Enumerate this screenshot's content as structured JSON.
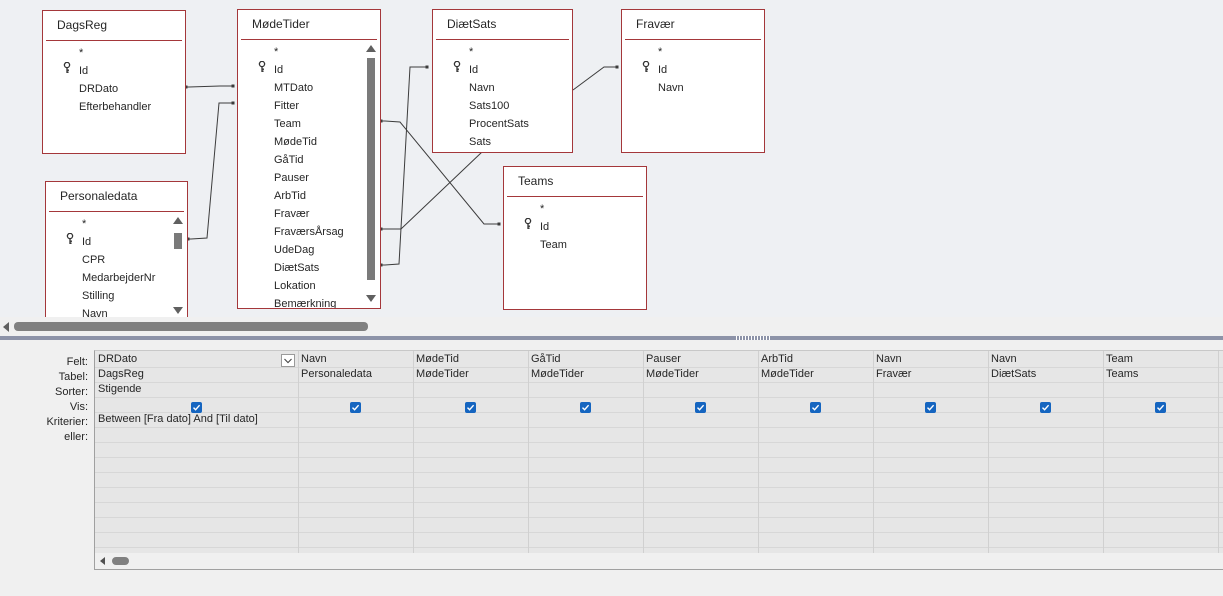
{
  "tables": [
    {
      "id": "dagsreg",
      "title": "DagsReg",
      "fields": [
        "*",
        "Id",
        "DRDato",
        "Efterbehandler"
      ],
      "key_index": 1,
      "scroll": false
    },
    {
      "id": "personaledata",
      "title": "Personaledata",
      "fields": [
        "*",
        "Id",
        "CPR",
        "MedarbejderNr",
        "Stilling",
        "Navn"
      ],
      "key_index": 1,
      "scroll": true
    },
    {
      "id": "modetider",
      "title": "MødeTider",
      "fields": [
        "*",
        "Id",
        "MTDato",
        "Fitter",
        "Team",
        "MødeTid",
        "GåTid",
        "Pauser",
        "ArbTid",
        "Fravær",
        "FraværsÅrsag",
        "UdeDag",
        "DiætSats",
        "Lokation",
        "Bemærkning"
      ],
      "key_index": 1,
      "scroll": true
    },
    {
      "id": "diatsats",
      "title": "DiætSats",
      "fields": [
        "*",
        "Id",
        "Navn",
        "Sats100",
        "ProcentSats",
        "Sats"
      ],
      "key_index": 1,
      "scroll": false
    },
    {
      "id": "fravaer",
      "title": "Fravær",
      "fields": [
        "*",
        "Id",
        "Navn"
      ],
      "key_index": 1,
      "scroll": false
    },
    {
      "id": "teams",
      "title": "Teams",
      "fields": [
        "*",
        "Id",
        "Team"
      ],
      "key_index": 1,
      "scroll": false
    }
  ],
  "grid": {
    "row_labels": [
      "Felt:",
      "Tabel:",
      "Sorter:",
      "Vis:",
      "Kriterier:",
      "eller:"
    ],
    "columns": [
      {
        "field": "DRDato",
        "table": "DagsReg",
        "sort": "Stigende",
        "show": true,
        "criteria": "Between [Fra dato] And [Til dato]",
        "active": true
      },
      {
        "field": "Navn",
        "table": "Personaledata",
        "sort": "",
        "show": true,
        "criteria": ""
      },
      {
        "field": "MødeTid",
        "table": "MødeTider",
        "sort": "",
        "show": true,
        "criteria": ""
      },
      {
        "field": "GåTid",
        "table": "MødeTider",
        "sort": "",
        "show": true,
        "criteria": ""
      },
      {
        "field": "Pauser",
        "table": "MødeTider",
        "sort": "",
        "show": true,
        "criteria": ""
      },
      {
        "field": "ArbTid",
        "table": "MødeTider",
        "sort": "",
        "show": true,
        "criteria": ""
      },
      {
        "field": "Navn",
        "table": "Fravær",
        "sort": "",
        "show": true,
        "criteria": ""
      },
      {
        "field": "Navn",
        "table": "DiætSats",
        "sort": "",
        "show": true,
        "criteria": ""
      },
      {
        "field": "Team",
        "table": "Teams",
        "sort": "",
        "show": true,
        "criteria": ""
      }
    ]
  },
  "colors": {
    "table_border": "#a4373a",
    "checkbox": "#1565c0",
    "splitter": "#8d93a8"
  },
  "icons": {
    "key": "key-icon",
    "checkbox": "checkmark-icon",
    "dropdown": "chevron-down-icon"
  }
}
